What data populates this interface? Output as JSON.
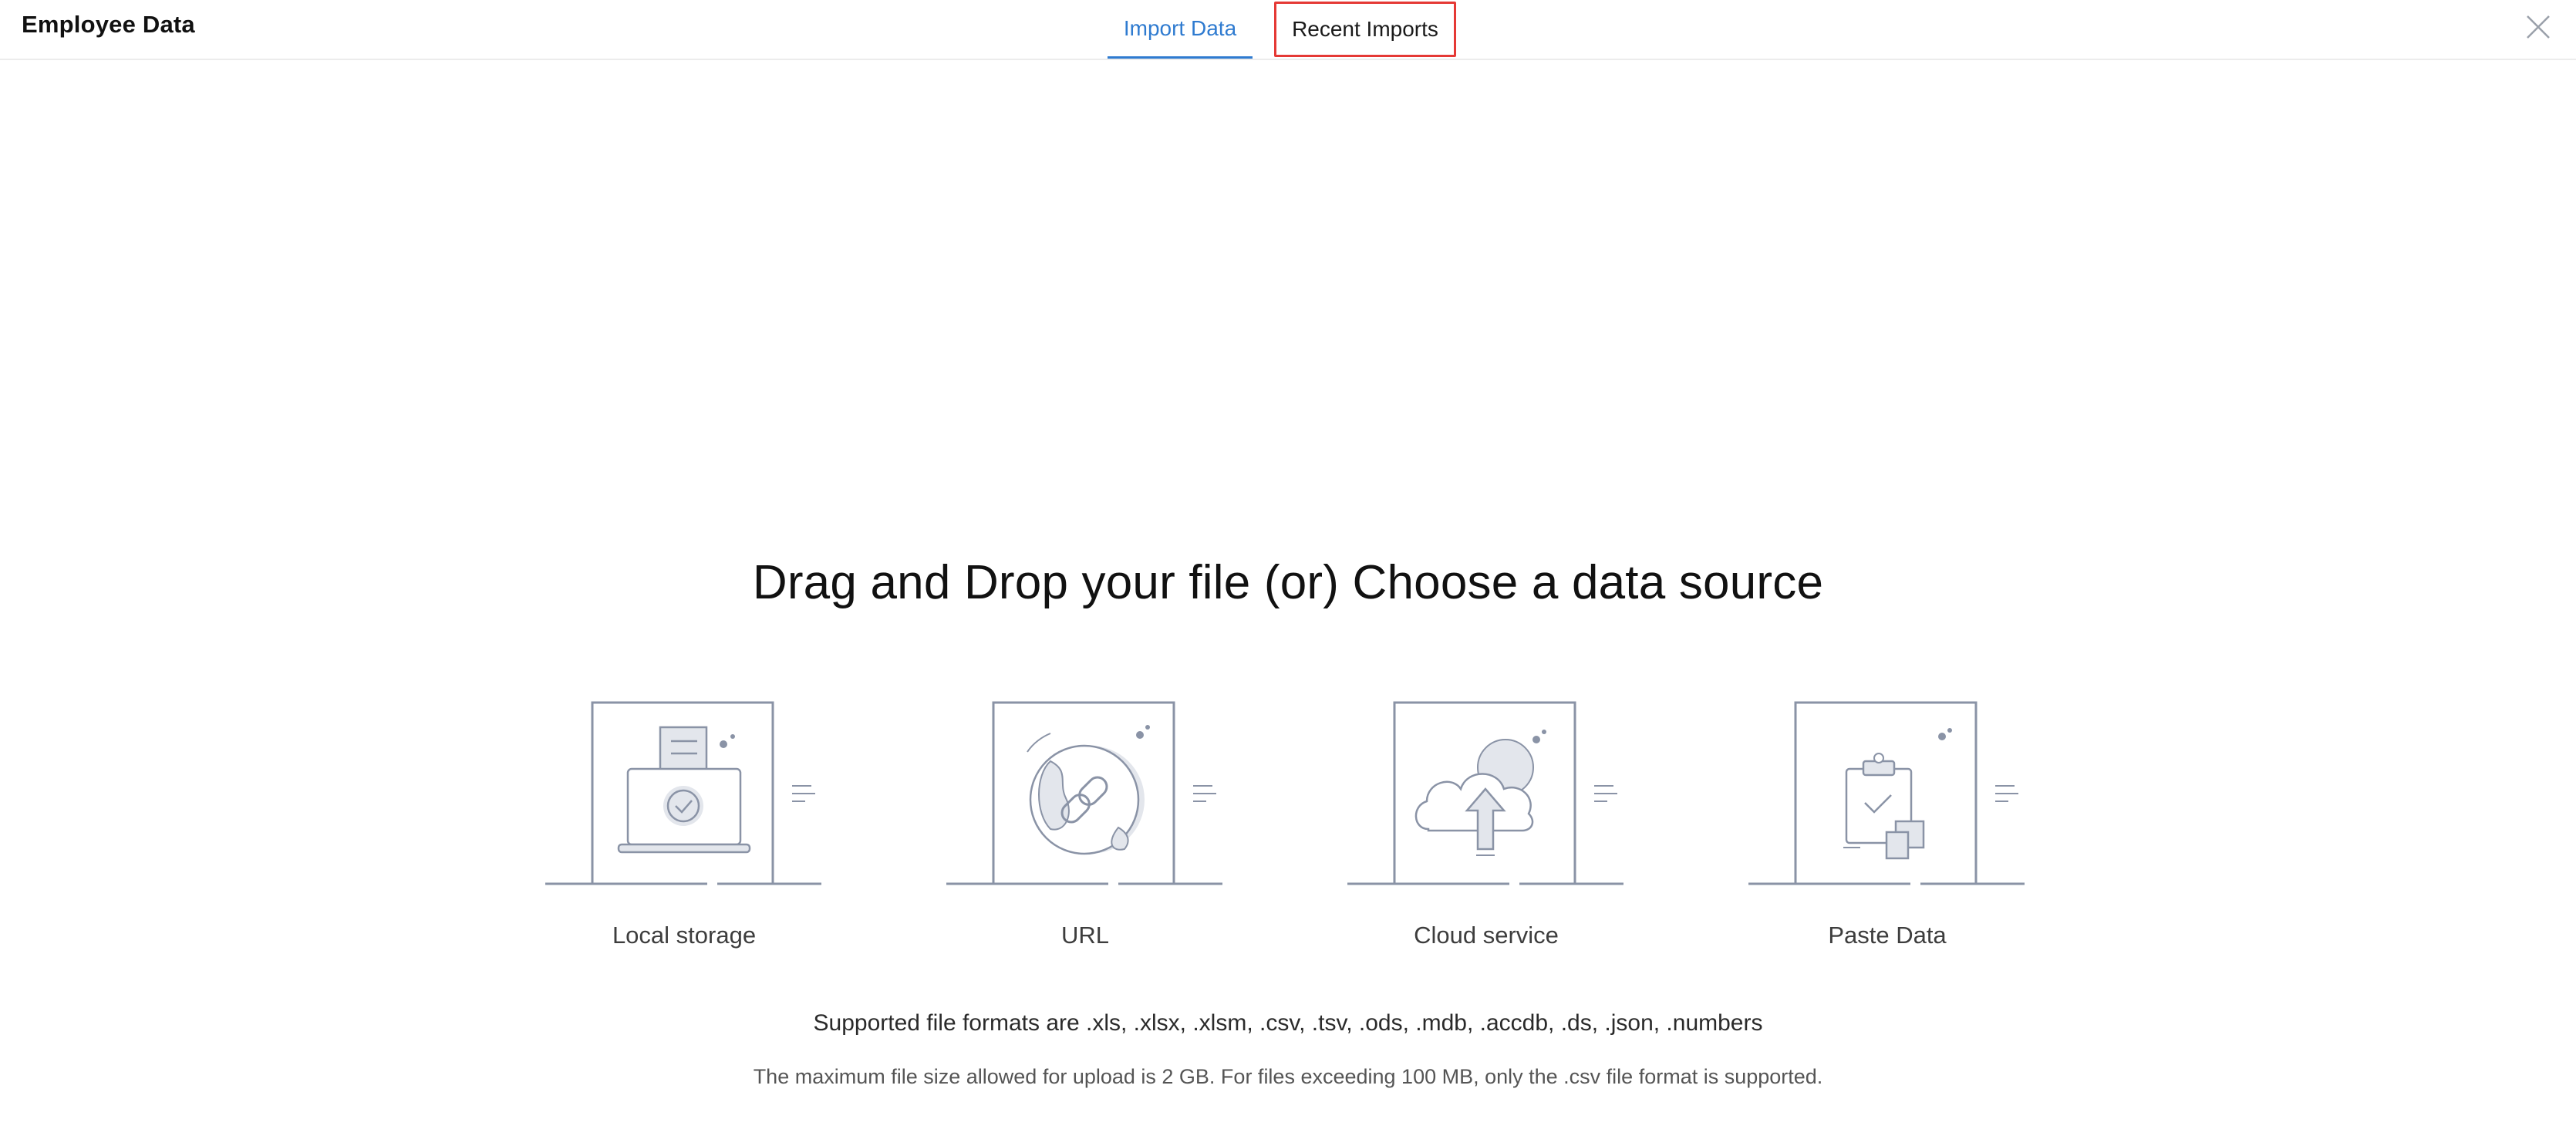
{
  "header": {
    "title": "Employee Data",
    "tabs": {
      "import": "Import Data",
      "recent": "Recent Imports"
    }
  },
  "main": {
    "headline": "Drag and Drop your file (or) Choose a data source",
    "sources": [
      {
        "label": "Local storage",
        "icon": "laptop-upload-icon"
      },
      {
        "label": "URL",
        "icon": "globe-link-icon"
      },
      {
        "label": "Cloud service",
        "icon": "cloud-upload-icon"
      },
      {
        "label": "Paste Data",
        "icon": "clipboard-paste-icon"
      }
    ],
    "formats_text": "Supported file formats are .xls, .xlsx, .xlsm, .csv, .tsv, .ods, .mdb, .accdb, .ds, .json, .numbers",
    "limit_text": "The maximum file size allowed for upload is 2 GB. For files exceeding 100 MB, only the .csv file format is supported."
  },
  "colors": {
    "accent": "#2f7bd0",
    "highlight_border": "#e53935",
    "icon_stroke": "#8a93a6",
    "icon_fill": "#e3e6ec"
  }
}
